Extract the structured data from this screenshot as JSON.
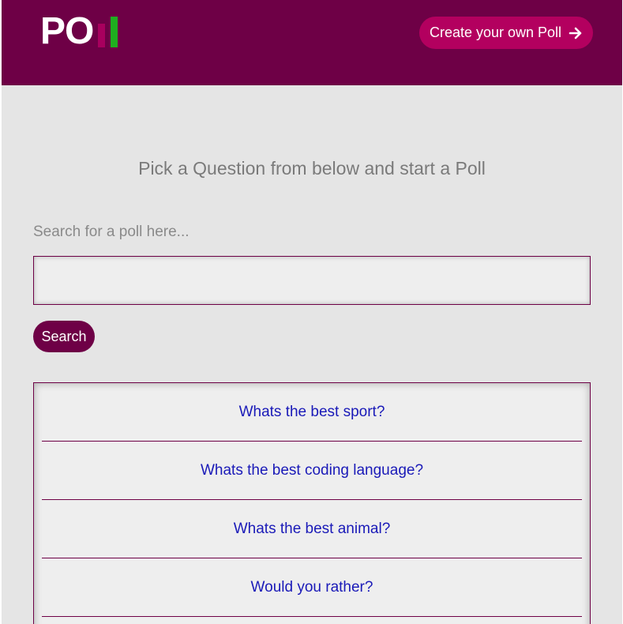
{
  "header": {
    "logo_text": "PO",
    "create_button_label": "Create your own Poll"
  },
  "colors": {
    "header_bg": "#6e0046",
    "accent": "#b3005f",
    "logo_bar_1": "#a8005e",
    "logo_bar_2": "#1fae1f",
    "page_bg": "#e5e5e5",
    "link": "#1a1ab8"
  },
  "main": {
    "headline": "Pick a Question from below and start a Poll",
    "search": {
      "label": "Search for a poll here...",
      "value": "",
      "button_label": "Search"
    },
    "polls": [
      {
        "label": "Whats the best sport?"
      },
      {
        "label": "Whats the best coding language?"
      },
      {
        "label": "Whats the best animal?"
      },
      {
        "label": "Would you rather?"
      }
    ]
  },
  "icons": {
    "create_button_icon": "arrow-right-icon"
  }
}
